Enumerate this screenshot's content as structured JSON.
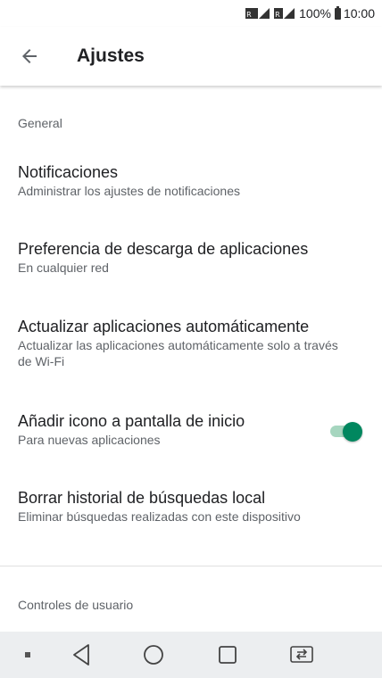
{
  "status_bar": {
    "sim_label_1": "R",
    "sim_label_2": "R",
    "battery": "100%",
    "time": "10:00"
  },
  "app_bar": {
    "back_icon": "arrow-back-icon",
    "title": "Ajustes"
  },
  "sections": {
    "general": {
      "header": "General",
      "items": [
        {
          "title": "Notificaciones",
          "subtitle": "Administrar los ajustes de notificaciones"
        },
        {
          "title": "Preferencia de descarga de aplicaciones",
          "subtitle": "En cualquier red"
        },
        {
          "title": "Actualizar aplicaciones automáticamente",
          "subtitle": "Actualizar las aplicaciones automáticamente solo a través de Wi-Fi"
        },
        {
          "title": "Añadir icono a pantalla de inicio",
          "subtitle": "Para nuevas aplicaciones",
          "toggle_on": true
        },
        {
          "title": "Borrar historial de búsquedas local",
          "subtitle": "Eliminar búsquedas realizadas con este dispositivo"
        }
      ]
    },
    "user_controls": {
      "header": "Controles de usuario"
    }
  },
  "colors": {
    "accent": "#01875f",
    "accent_track": "#a6d6bf",
    "text_primary": "#202124",
    "text_secondary": "#5f6368",
    "nav_bar_bg": "#eceef0"
  },
  "nav_bar": {
    "icons": [
      "dot-icon",
      "back-triangle-icon",
      "home-circle-icon",
      "recents-square-icon",
      "sim-switch-icon"
    ]
  }
}
